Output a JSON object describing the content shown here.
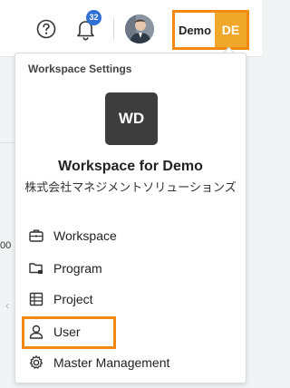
{
  "topbar": {
    "notification_count": "32",
    "workspace_switcher": {
      "name": "Demo",
      "code": "DE"
    }
  },
  "background": {
    "partial_text": "00",
    "chevron": "‹"
  },
  "dropdown": {
    "header": "Workspace Settings",
    "logo_initials": "WD",
    "workspace_title": "Workspace for Demo",
    "company_name": "株式会社マネジメントソリューションズ",
    "items": [
      {
        "label": "Workspace",
        "icon": "briefcase-icon"
      },
      {
        "label": "Program",
        "icon": "folders-icon"
      },
      {
        "label": "Project",
        "icon": "grid-table-icon"
      },
      {
        "label": "User",
        "icon": "user-icon"
      },
      {
        "label": "Master Management",
        "icon": "gear-icon"
      }
    ]
  },
  "colors": {
    "highlight": "#f28a12",
    "workspace_code_bg": "#f0a82a",
    "badge": "#2f6fd6",
    "logo_bg": "#3d3d3d"
  }
}
